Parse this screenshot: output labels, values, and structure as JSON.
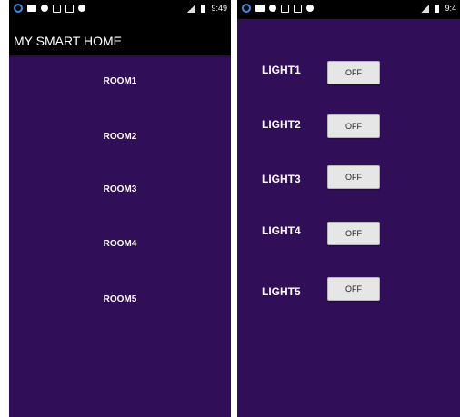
{
  "screen_left": {
    "status": {
      "time": "9:49"
    },
    "app_title": "MY SMART HOME",
    "rooms": [
      {
        "label": "ROOM1"
      },
      {
        "label": "ROOM2"
      },
      {
        "label": "ROOM3"
      },
      {
        "label": "ROOM4"
      },
      {
        "label": "ROOM5"
      }
    ]
  },
  "screen_right": {
    "status": {
      "time": "9:4"
    },
    "lights": [
      {
        "label": "LIGHT1",
        "button": "OFF"
      },
      {
        "label": "LIGHT2",
        "button": "OFF"
      },
      {
        "label": "LIGHT3",
        "button": "OFF"
      },
      {
        "label": "LIGHT4",
        "button": "OFF"
      },
      {
        "label": "LIGHT5",
        "button": "OFF"
      }
    ]
  },
  "colors": {
    "background": "#310e58",
    "appbar": "#000000",
    "button": "#e6e6e6"
  },
  "icons": [
    "notification-icon",
    "media-icon",
    "image-icon",
    "tools-icon",
    "alarm-icon",
    "signal-icon",
    "battery-icon"
  ]
}
